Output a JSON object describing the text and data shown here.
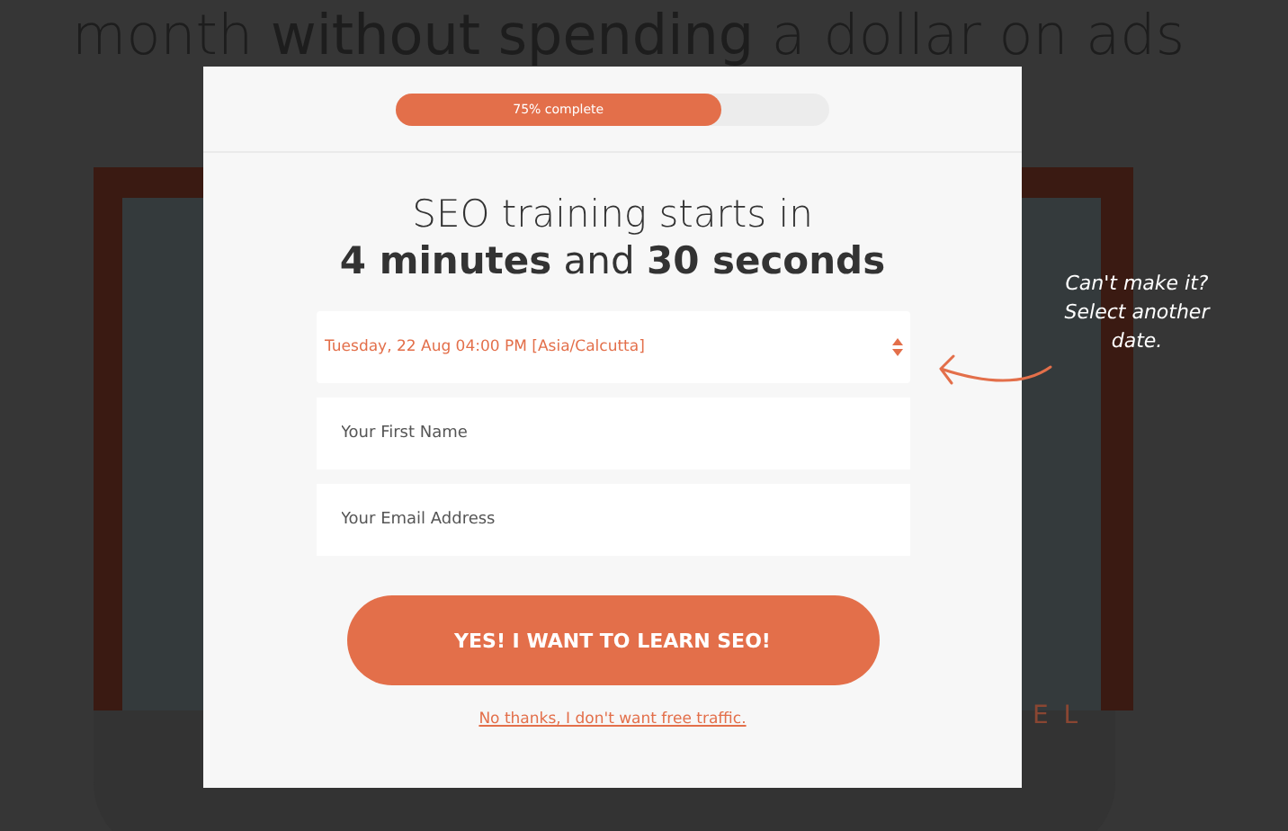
{
  "background": {
    "headline": "month **without spending** a dollar on ads",
    "logo_fragment": "E L"
  },
  "modal": {
    "progress": {
      "label": "75% complete",
      "level": 0.75
    },
    "heading": {
      "line_1": "SEO training starts in",
      "line_2": "**4 minutes** and **30 seconds**"
    },
    "date_select": {
      "value": "Tuesday, 22 Aug 04:00 PM [Asia/Calcutta]"
    },
    "fields": [
      {
        "placeholder": "Your First Name"
      },
      {
        "placeholder": "Your Email Address"
      }
    ],
    "submit_button": "YES! I WANT TO LEARN SEO!",
    "decline_link": "No thanks, I don't want free traffic."
  },
  "annotation": "Can't make it? Select another date."
}
